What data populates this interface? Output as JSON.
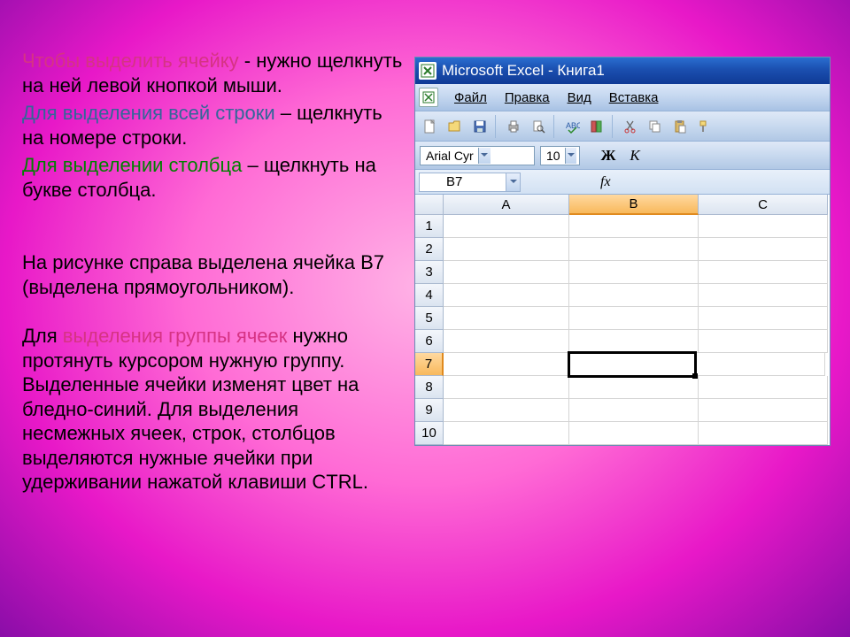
{
  "text": {
    "p1a": "Чтобы выделить ячейку",
    "p1b": "  -  нужно щелкнуть на ней левой кнопкой мыши.",
    "p2a": "Для выделения всей строки",
    "p2b": " – щелкнуть на номере строки.",
    "p3a": "Для выделении столбца",
    "p3b": " – щелкнуть на букве столбца.",
    "p4": "На рисунке справа выделена ячейка В7 (выделена прямоугольником).",
    "p5a": "Для ",
    "p5b": "выделения группы ячеек",
    "p5c": " нужно протянуть курсором нужную группу. Выделенные ячейки изменят цвет на бледно-синий. Для выделения несмежных ячеек, строк, столбцов выделяются нужные ячейки при удерживании нажатой клавиши CTRL."
  },
  "excel": {
    "title": "Microsoft Excel - Книга1",
    "menu": {
      "file": "Файл",
      "edit": "Правка",
      "view": "Вид",
      "insert": "Вставка"
    },
    "font": {
      "name": "Arial Cyr",
      "size": "10",
      "bold": "Ж",
      "italic": "К"
    },
    "namebox": "B7",
    "fx": "fx",
    "cols": {
      "a": "A",
      "b": "B",
      "c": "C"
    },
    "rows": [
      "1",
      "2",
      "3",
      "4",
      "5",
      "6",
      "7",
      "8",
      "9",
      "10"
    ]
  }
}
